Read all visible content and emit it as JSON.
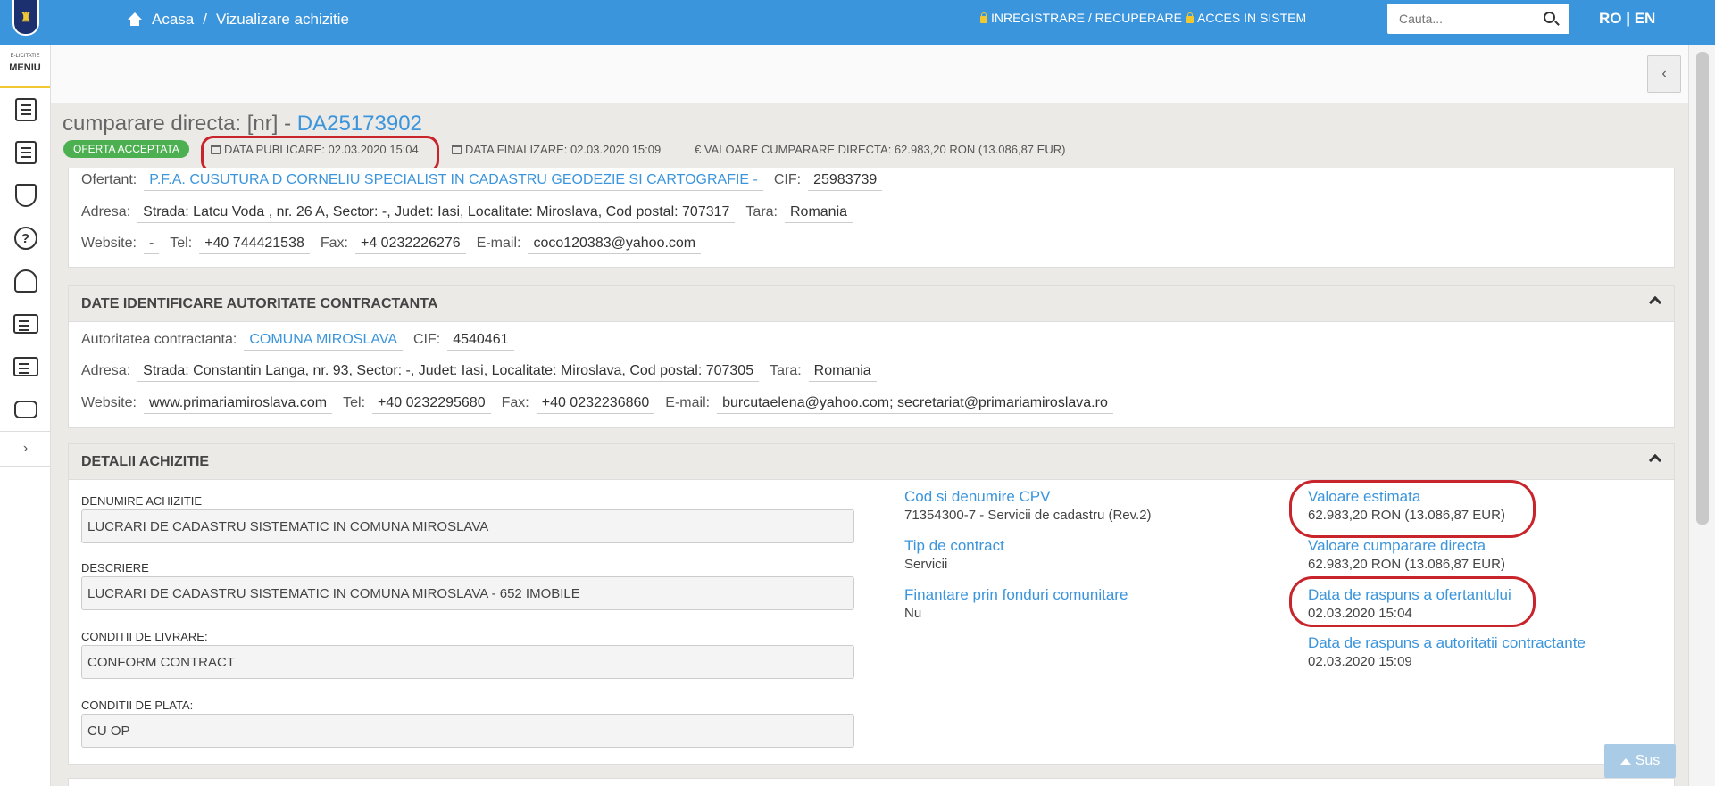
{
  "topbar": {
    "crumb_home": "Acasa",
    "crumb_sep": "/",
    "crumb_current": "Vizualizare achizitie",
    "register_link": "INREGISTRARE / RECUPERARE",
    "login_link": "ACCES IN SISTEM",
    "search_placeholder": "Cauta...",
    "lang": "RO | EN"
  },
  "sidebar": {
    "small_text": "E-LICITATIE",
    "menu_label": "MENIU",
    "icons": [
      "document-icon",
      "list-arrow-icon",
      "shield-icon",
      "help-icon",
      "tree-icon",
      "id-card-icon",
      "building-icon",
      "chat-icon"
    ],
    "help_glyph": "?",
    "expand_glyph": "›"
  },
  "header": {
    "collapse_glyph": "‹",
    "title_prefix": "cumparare directa: [nr] - ",
    "title_id": "DA25173902",
    "badge": "OFERTA ACCEPTATA",
    "data_publicare": "DATA PUBLICARE: 02.03.2020 15:04",
    "data_finalizare": "DATA FINALIZARE: 02.03.2020 15:09",
    "valoare": "€ VALOARE CUMPARARE DIRECTA: 62.983,20  RON (13.086,87  EUR)"
  },
  "ofertant": {
    "ofertant_label": "Ofertant:",
    "ofertant_value": "P.F.A. CUSUTURA D CORNELIU SPECIALIST IN CADASTRU GEODEZIE SI CARTOGRAFIE -",
    "cif_label": "CIF:",
    "cif_value": "25983739",
    "adresa_label": "Adresa:",
    "adresa_value": "Strada: Latcu Voda , nr. 26 A, Sector: -, Judet: Iasi, Localitate: Miroslava, Cod postal: 707317",
    "tara_label": "Tara:",
    "tara_value": "Romania",
    "website_label": "Website:",
    "website_value": "-",
    "tel_label": "Tel:",
    "tel_value": "+40 744421538",
    "fax_label": "Fax:",
    "fax_value": "+4 0232226276",
    "email_label": "E-mail:",
    "email_value": "coco120383@yahoo.com"
  },
  "autoritate": {
    "heading": "DATE IDENTIFICARE AUTORITATE CONTRACTANTA",
    "autoritate_label": "Autoritatea contractanta:",
    "autoritate_value": "COMUNA MIROSLAVA",
    "cif_label": "CIF:",
    "cif_value": "4540461",
    "adresa_label": "Adresa:",
    "adresa_value": "Strada: Constantin Langa, nr. 93, Sector: -, Judet: Iasi, Localitate: Miroslava, Cod postal: 707305",
    "tara_label": "Tara:",
    "tara_value": "Romania",
    "website_label": "Website:",
    "website_value": "www.primariamiroslava.com",
    "tel_label": "Tel:",
    "tel_value": "+40 0232295680",
    "fax_label": "Fax:",
    "fax_value": "+40 0232236860",
    "email_label": "E-mail:",
    "email_value": "burcutaelena@yahoo.com; secretariat@primariamiroslava.ro"
  },
  "detalii": {
    "heading": "DETALII ACHIZITIE",
    "denumire_label": "DENUMIRE ACHIZITIE",
    "denumire_value": "LUCRARI DE CADASTRU SISTEMATIC IN COMUNA MIROSLAVA",
    "descriere_label": "DESCRIERE",
    "descriere_value": "LUCRARI DE CADASTRU SISTEMATIC IN COMUNA MIROSLAVA - 652 IMOBILE",
    "livrare_label": "CONDITII DE LIVRARE:",
    "livrare_value": "CONFORM CONTRACT",
    "plata_label": "CONDITII DE PLATA:",
    "plata_value": "CU OP",
    "cpv_label": "Cod si denumire CPV",
    "cpv_value": "71354300-7 - Servicii de cadastru (Rev.2)",
    "tip_label": "Tip de contract",
    "tip_value": "Servicii",
    "finantare_label": "Finantare prin fonduri comunitare",
    "finantare_value": "Nu",
    "estimata_label": "Valoare estimata",
    "estimata_value": "62.983,20  RON (13.086,87  EUR)",
    "cumparare_label": "Valoare cumparare directa",
    "cumparare_value": "62.983,20  RON (13.086,87  EUR)",
    "raspuns_ofertant_label": "Data de raspuns a ofertantului",
    "raspuns_ofertant_value": "02.03.2020 15:04",
    "raspuns_autoritate_label": "Data de raspuns a autoritatii contractante",
    "raspuns_autoritate_value": "02.03.2020 15:09"
  },
  "footer": {
    "sus_label": "Sus"
  }
}
